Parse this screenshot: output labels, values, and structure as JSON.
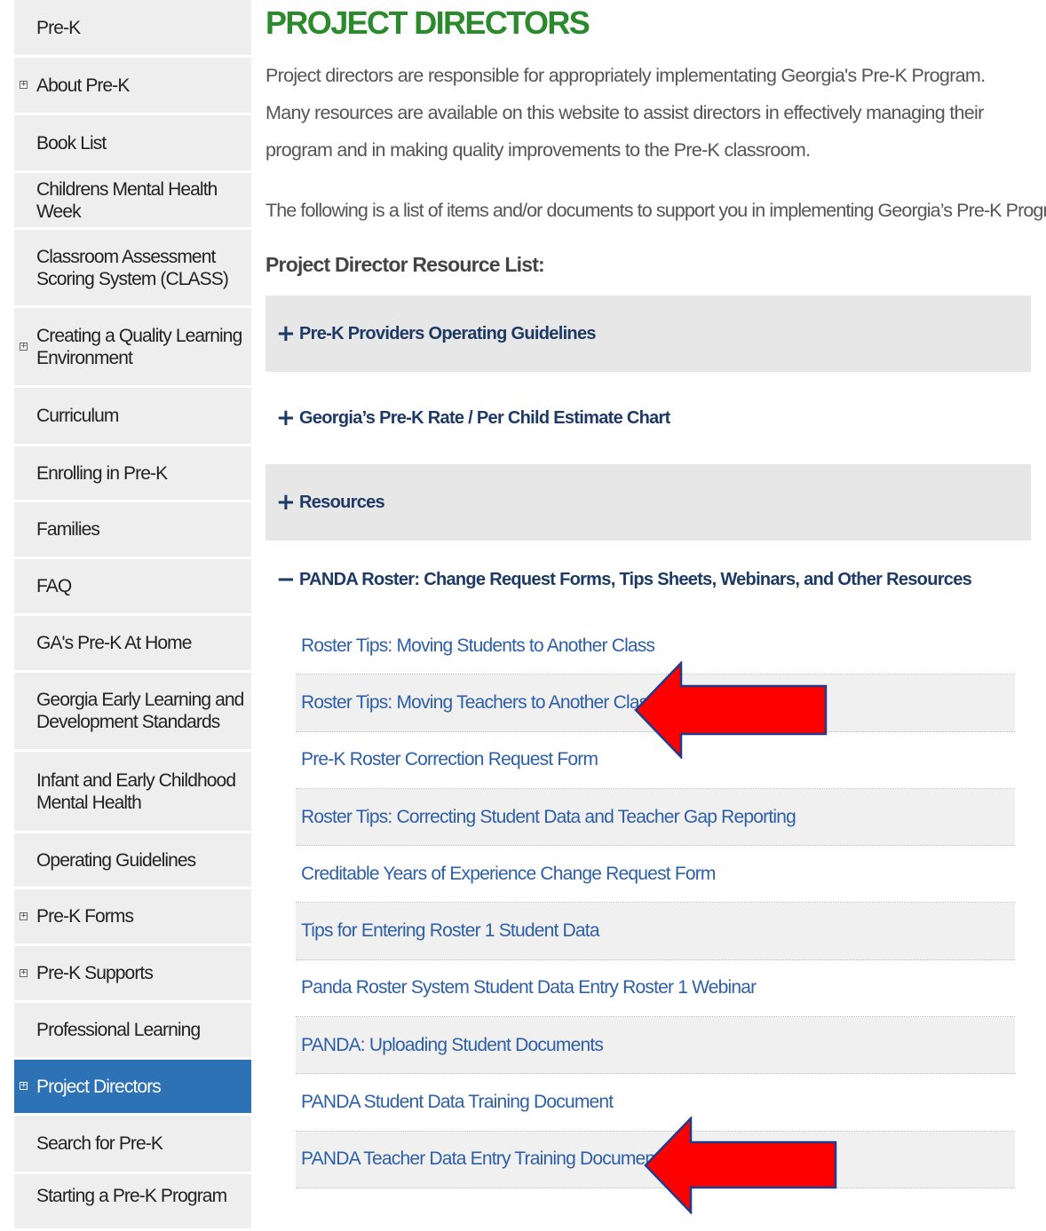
{
  "sidebar": {
    "items": [
      {
        "label": "Pre-K",
        "expandable": false,
        "active": false
      },
      {
        "label": "About Pre-K",
        "expandable": true,
        "active": false
      },
      {
        "label": "Book List",
        "expandable": false,
        "active": false
      },
      {
        "label": "Childrens Mental Health Week",
        "expandable": false,
        "active": false
      },
      {
        "label": "Classroom Assessment Scoring System (CLASS)",
        "expandable": false,
        "active": false
      },
      {
        "label": "Creating a Quality Learning Environment",
        "expandable": true,
        "active": false
      },
      {
        "label": "Curriculum",
        "expandable": false,
        "active": false
      },
      {
        "label": "Enrolling in Pre-K",
        "expandable": false,
        "active": false
      },
      {
        "label": "Families",
        "expandable": false,
        "active": false
      },
      {
        "label": "FAQ",
        "expandable": false,
        "active": false
      },
      {
        "label": "GA's Pre-K At Home",
        "expandable": false,
        "active": false
      },
      {
        "label": "Georgia Early Learning and Development Standards",
        "expandable": false,
        "active": false
      },
      {
        "label": "Infant and Early Childhood Mental Health",
        "expandable": false,
        "active": false
      },
      {
        "label": "Operating Guidelines",
        "expandable": false,
        "active": false
      },
      {
        "label": "Pre-K Forms",
        "expandable": true,
        "active": false
      },
      {
        "label": "Pre-K Supports",
        "expandable": true,
        "active": false
      },
      {
        "label": "Professional Learning",
        "expandable": false,
        "active": false
      },
      {
        "label": "Project Directors",
        "expandable": true,
        "active": true
      },
      {
        "label": "Search for Pre-K",
        "expandable": false,
        "active": false
      },
      {
        "label": "Starting a Pre-K Program",
        "expandable": false,
        "active": false
      }
    ],
    "expand_glyph": "+"
  },
  "main": {
    "title": "PROJECT DIRECTORS",
    "intro": "Project directors are responsible for appropriately implementating Georgia's Pre-K Program. Many resources are available on this website to assist directors in effectively managing their program and in making quality improvements to the Pre-K classroom.",
    "intro2": "The following is a list of items and/or documents to support you in implementing Georgia’s Pre-K Program.",
    "resource_heading": "Project Director Resource List:",
    "accordion": {
      "collapsed_sign": "+",
      "expanded_sign": "−",
      "sections": [
        {
          "title": "Pre-K Providers Operating Guidelines",
          "expanded": false
        },
        {
          "title": "Georgia’s Pre-K Rate / Per Child Estimate Chart",
          "expanded": false
        },
        {
          "title": "Resources",
          "expanded": false
        },
        {
          "title": "PANDA Roster: Change Request Forms, Tips Sheets, Webinars, and Other Resources",
          "expanded": true
        }
      ],
      "links": [
        "Roster Tips: Moving Students to Another Class",
        "Roster Tips: Moving Teachers to Another Class",
        "Pre-K Roster Correction Request Form",
        "Roster Tips: Correcting Student Data and Teacher Gap Reporting",
        "Creditable Years of Experience Change Request Form",
        "Tips for Entering Roster 1 Student Data",
        "Panda Roster System Student Data Entry Roster 1 Webinar",
        "PANDA: Uploading Student Documents",
        "PANDA Student Data Training Document",
        "PANDA Teacher Data Entry Training Document"
      ]
    }
  },
  "colors": {
    "title_green": "#2b8a2b",
    "link_blue": "#2d5fa8",
    "header_navy": "#1d3a66",
    "active_nav": "#2e72b6",
    "arrow_red": "#ff0000",
    "arrow_outline": "#1f3b8a"
  },
  "annotations": {
    "arrow_icon": "red-arrow-left"
  }
}
